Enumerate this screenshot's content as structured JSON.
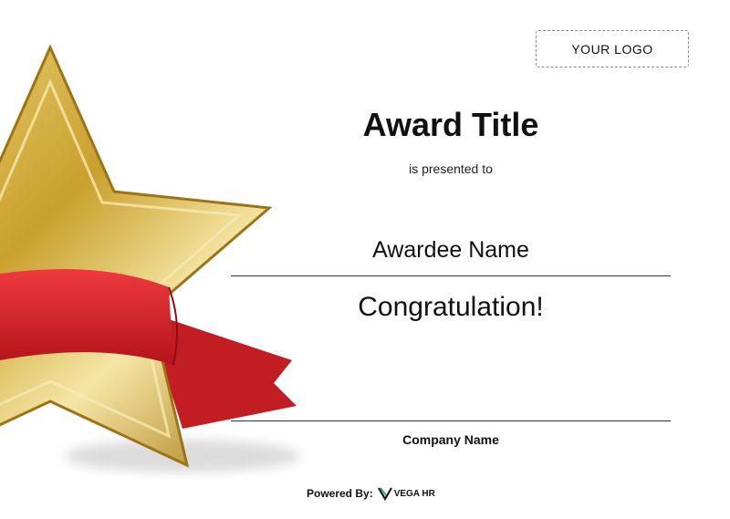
{
  "logo": {
    "label": "YOUR LOGO"
  },
  "award": {
    "title": "Award Title",
    "subtitle": "is presented to",
    "awardee": "Awardee Name",
    "message": "Congratulation!",
    "company": "Company Name"
  },
  "footer": {
    "powered_label": "Powered By:",
    "brand": "VEGA HR"
  },
  "colors": {
    "gold": "#c9a02c",
    "red": "#d8262b"
  },
  "icons": {
    "star": "star-icon",
    "brand": "vega-hr-logo-icon"
  }
}
